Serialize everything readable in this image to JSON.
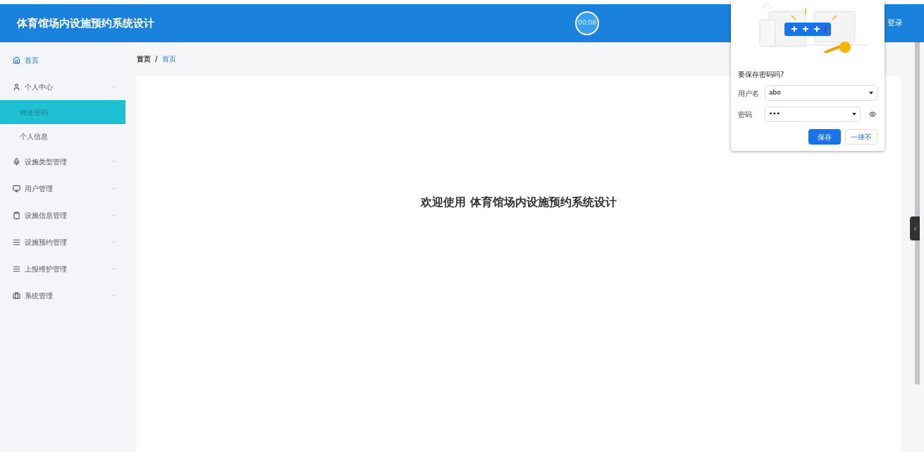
{
  "header": {
    "title": "体育馆场内设施预约系统设计",
    "timer": "00:08",
    "login": "登录"
  },
  "sidebar": {
    "items": [
      {
        "label": "首页",
        "selected": true
      },
      {
        "label": "个人中心",
        "selected": false,
        "expanded": true,
        "children": [
          {
            "label": "修改密码",
            "selected": true
          },
          {
            "label": "个人信息",
            "selected": false
          }
        ]
      },
      {
        "label": "设施类型管理",
        "selected": false,
        "expanded": false
      },
      {
        "label": "用户管理",
        "selected": false,
        "expanded": false
      },
      {
        "label": "设施信息管理",
        "selected": false,
        "expanded": false
      },
      {
        "label": "设施预约管理",
        "selected": false,
        "expanded": false
      },
      {
        "label": "上报维护管理",
        "selected": false,
        "expanded": false
      },
      {
        "label": "系统管理",
        "selected": false,
        "expanded": false
      }
    ]
  },
  "breadcrumb": {
    "items": [
      "首页",
      "首页"
    ],
    "separator": "/"
  },
  "welcome": "欢迎使用 体育馆场内设施预约系统设计",
  "password_popup": {
    "title": "要保存密码吗?",
    "fields": [
      {
        "label": "用户名",
        "value": "abo"
      },
      {
        "label": "密码",
        "value": "•••"
      }
    ],
    "buttons": [
      "保存",
      "一律不"
    ]
  }
}
